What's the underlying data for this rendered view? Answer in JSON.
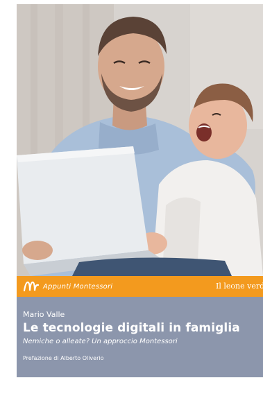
{
  "cover": {
    "series_name": "Appunti Montessori",
    "publisher": "Il leone verde",
    "author": "Mario Valle",
    "title": "Le tecnologie digitali in famiglia",
    "subtitle": "Nemiche o alleate? Un approccio Montessori",
    "preface": "Prefazione di Alberto Oliverio"
  },
  "colors": {
    "band": "#f39a1e",
    "panel": "#8c96ac",
    "text": "#ffffff"
  }
}
